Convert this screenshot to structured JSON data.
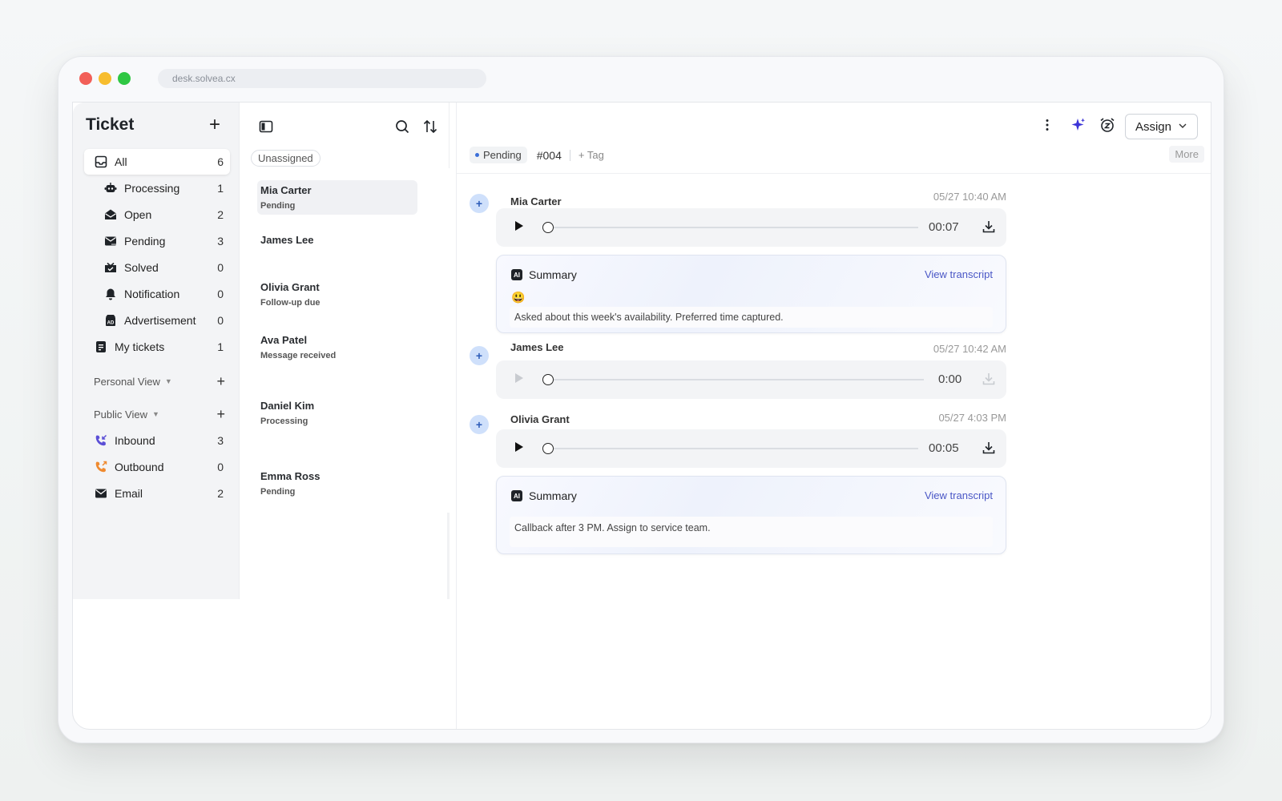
{
  "browser": {
    "address": "desk.solvea.cx"
  },
  "sidebar": {
    "title": "Ticket",
    "items": [
      {
        "label": "All",
        "count": "6",
        "icon": "inbox-icon"
      },
      {
        "label": "Processing",
        "count": "1",
        "icon": "robot-icon"
      },
      {
        "label": "Open",
        "count": "2",
        "icon": "envelope-open-icon"
      },
      {
        "label": "Pending",
        "count": "3",
        "icon": "mail-pending-icon"
      },
      {
        "label": "Solved",
        "count": "0",
        "icon": "tray-check-icon"
      },
      {
        "label": "Notification",
        "count": "0",
        "icon": "bell-icon"
      },
      {
        "label": "Advertisement",
        "count": "0",
        "icon": "ad-icon"
      },
      {
        "label": "My tickets",
        "count": "1",
        "icon": "document-icon"
      }
    ],
    "personal_view": "Personal View",
    "public_view": "Public View",
    "public_items": [
      {
        "label": "Inbound",
        "count": "3",
        "icon": "phone-incoming-icon",
        "color": "#5b4fd6"
      },
      {
        "label": "Outbound",
        "count": "0",
        "icon": "phone-outgoing-icon",
        "color": "#ef8a2f"
      },
      {
        "label": "Email",
        "count": "2",
        "icon": "mail-icon"
      }
    ]
  },
  "list": {
    "filter_chip": "Unassigned",
    "tickets": [
      {
        "name": "Mia Carter",
        "status": "Pending"
      },
      {
        "name": "James Lee",
        "status": ""
      },
      {
        "name": "Olivia Grant",
        "status": "Follow-up due"
      },
      {
        "name": "Ava Patel",
        "status": "Message received"
      },
      {
        "name": "Daniel Kim",
        "status": "Processing"
      },
      {
        "name": "Emma Ross",
        "status": "Pending"
      }
    ]
  },
  "main": {
    "assign_label": "Assign",
    "status_badge": "Pending",
    "ticket_id": "#004",
    "tag_label": "+ Tag",
    "more_label": "More",
    "messages": [
      {
        "sender": "Mia Carter",
        "time": "05/27 10:40 AM",
        "duration": "00:07",
        "progress": 0,
        "summary": {
          "title": "Summary",
          "link": "View transcript",
          "emoji": "😃",
          "text": "Asked about this week's availability. Preferred time captured."
        }
      },
      {
        "sender": "James Lee",
        "time": "05/27 10:42 AM",
        "duration": "0:00",
        "progress": 0
      },
      {
        "sender": "Olivia Grant",
        "time": "05/27 4:03 PM",
        "duration": "00:05",
        "progress": 0,
        "summary": {
          "title": "Summary",
          "link": "View transcript",
          "text": "Callback after 3 PM. Assign to service team."
        }
      }
    ]
  },
  "colors": {
    "accent": "#4a57c6",
    "sparkle": "#3d35d8",
    "status_dot": "#3b6fd8"
  }
}
